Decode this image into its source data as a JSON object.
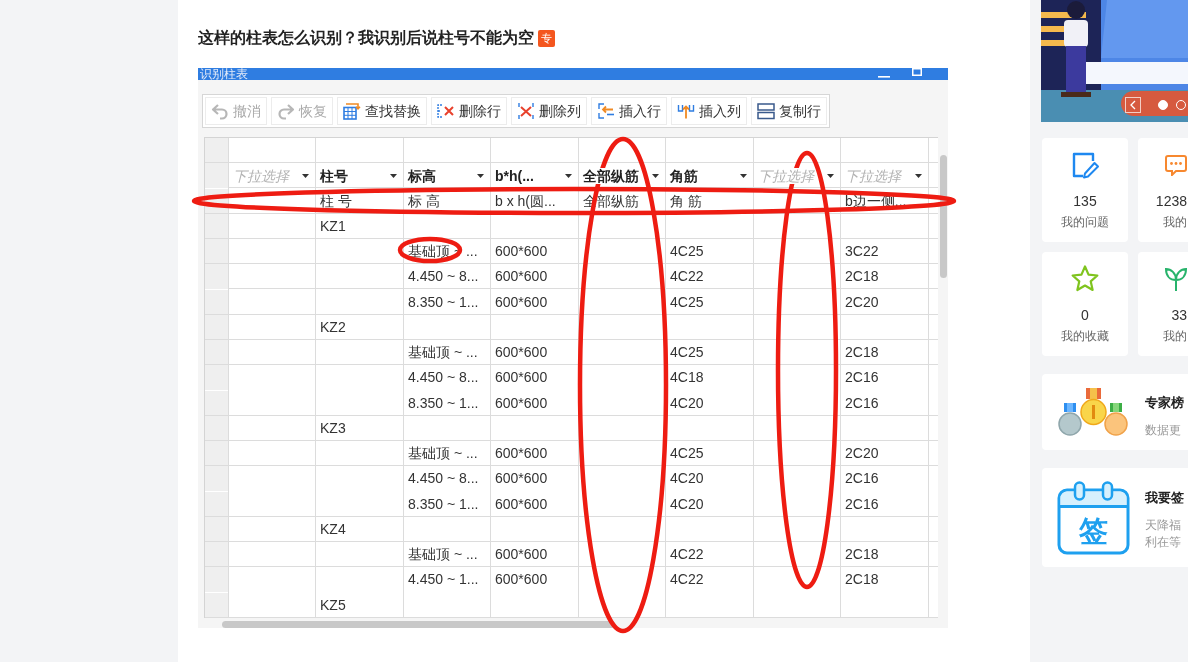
{
  "question": {
    "title": "这样的柱表怎么识别？我识别后说柱号不能为空",
    "badge": "专"
  },
  "screenshot": {
    "window": {
      "title": "识别柱表"
    },
    "toolbar": [
      {
        "kind": "undo",
        "label": "撤消",
        "disabled": true
      },
      {
        "kind": "redo",
        "label": "恢复",
        "disabled": true
      },
      {
        "kind": "find-replace",
        "label": "查找替换",
        "disabled": false
      },
      {
        "kind": "delete-row",
        "label": "删除行",
        "disabled": false
      },
      {
        "kind": "delete-column",
        "label": "删除列",
        "disabled": false
      },
      {
        "kind": "insert-row",
        "label": "插入行",
        "disabled": false
      },
      {
        "kind": "insert-column",
        "label": "插入列",
        "disabled": false
      },
      {
        "kind": "copy-row",
        "label": "复制行",
        "disabled": false
      }
    ],
    "table": {
      "columns": [
        {
          "placeholder": "下拉选择"
        },
        {
          "value": "柱号"
        },
        {
          "value": "标高"
        },
        {
          "value": "b*h(..."
        },
        {
          "value": "全部纵筋"
        },
        {
          "value": "角筋"
        },
        {
          "placeholder": "下拉选择"
        },
        {
          "placeholder": "下拉选择"
        }
      ],
      "rows": [
        {
          "column_2": "柱 号",
          "column_3": "标 高",
          "column_4": "b x h(圆...",
          "column_5": "全部纵筋",
          "column_6": "角 筋",
          "column_8": "b边一侧..."
        },
        {
          "column_2": "KZ1"
        },
        {
          "column_3": "基础顶 ~ ...",
          "column_4": "600*600",
          "column_6": "4C25",
          "column_8": "3C22"
        },
        {
          "column_3": "4.450 ~ 8...",
          "column_4": "600*600",
          "column_6": "4C22",
          "column_8": "2C18"
        },
        {
          "column_3": "8.350 ~ 1...",
          "column_4": "600*600",
          "column_6": "4C25",
          "column_8": "2C20"
        },
        {
          "column_2": "KZ2"
        },
        {
          "column_3": "基础顶 ~ ...",
          "column_4": "600*600",
          "column_6": "4C25",
          "column_8": "2C18"
        },
        {
          "column_3": "4.450 ~ 8...",
          "column_4": "600*600",
          "column_6": "4C18",
          "column_8": "2C16"
        },
        {
          "column_3": "8.350 ~ 1...",
          "column_4": "600*600",
          "column_6": "4C20",
          "column_8": "2C16"
        },
        {
          "column_2": "KZ3"
        },
        {
          "column_3": "基础顶 ~ ...",
          "column_4": "600*600",
          "column_6": "4C25",
          "column_8": "2C20"
        },
        {
          "column_3": "4.450 ~ 8...",
          "column_4": "600*600",
          "column_6": "4C20",
          "column_8": "2C16"
        },
        {
          "column_3": "8.350 ~ 1...",
          "column_4": "600*600",
          "column_6": "4C20",
          "column_8": "2C16"
        },
        {
          "column_2": "KZ4"
        },
        {
          "column_3": "基础顶 ~ ...",
          "column_4": "600*600",
          "column_6": "4C22",
          "column_8": "2C18"
        },
        {
          "column_3": "4.450 ~ 1...",
          "column_4": "600*600",
          "column_6": "4C22",
          "column_8": "2C18"
        },
        {
          "column_2": "KZ5"
        }
      ]
    },
    "annotations": [
      {
        "kind": "ellipse"
      },
      {
        "kind": "ellipse"
      },
      {
        "kind": "ellipse"
      },
      {
        "kind": "ellipse"
      }
    ]
  },
  "sidebar": {
    "banner": {
      "dots": [
        {
          "selected": true
        },
        {
          "selected": false
        }
      ]
    },
    "stats": [
      {
        "kind": "questions",
        "count": "135",
        "label": "我的问题"
      },
      {
        "kind": "answers",
        "count": "1238",
        "label": "我的"
      },
      {
        "kind": "favorites",
        "count": "0",
        "label": "我的收藏"
      },
      {
        "kind": "level",
        "count": "33",
        "label": "我的"
      }
    ],
    "ranking": {
      "title": "专家榜",
      "subtitle": "数据更"
    },
    "sign_in": {
      "title": "我要签",
      "icon_text": "签",
      "description": "天降福利在等"
    }
  }
}
